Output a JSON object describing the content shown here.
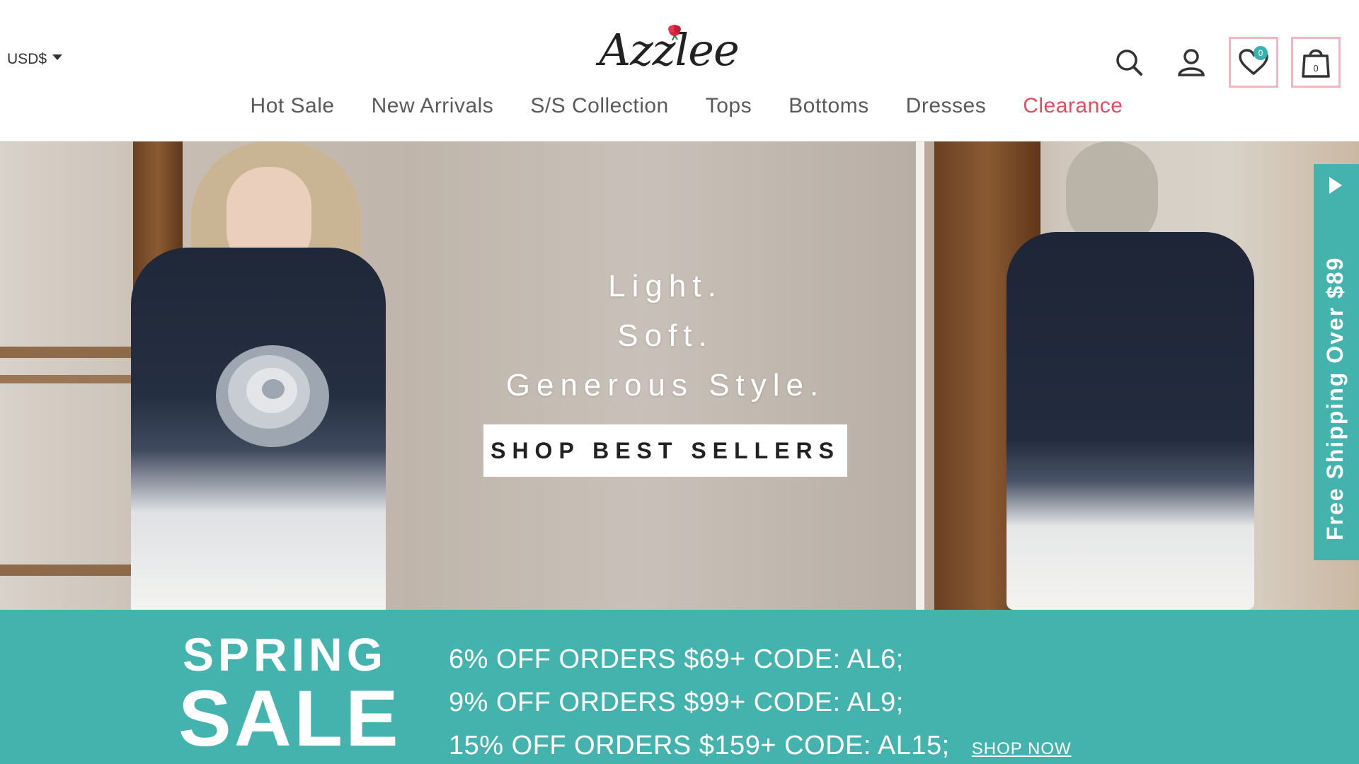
{
  "header": {
    "currency": "USD$",
    "logo": "Azzlee",
    "wishlist_count": "0",
    "cart_count": "0"
  },
  "nav": {
    "items": [
      {
        "label": "Hot Sale"
      },
      {
        "label": "New Arrivals"
      },
      {
        "label": "S/S Collection"
      },
      {
        "label": "Tops"
      },
      {
        "label": "Bottoms"
      },
      {
        "label": "Dresses"
      },
      {
        "label": "Clearance"
      }
    ]
  },
  "hero": {
    "lines": [
      "Light.",
      "Soft.",
      "Generous Style."
    ],
    "cta_label": "SHOP BEST SELLERS"
  },
  "shipping_tab": {
    "label": "Free Shipping Over $89"
  },
  "promo": {
    "spring": "SPRING",
    "sale": "SALE",
    "offers": [
      "6% OFF ORDERS $69+ CODE: AL6;",
      "9% OFF ORDERS $99+ CODE: AL9;",
      "15% OFF ORDERS $159+ CODE: AL15;"
    ],
    "shop_now": "SHOP NOW"
  },
  "colors": {
    "accent_teal": "#45b3ad",
    "clearance_red": "#e84a5f",
    "icon_frame_pink": "#f3b6c0"
  }
}
